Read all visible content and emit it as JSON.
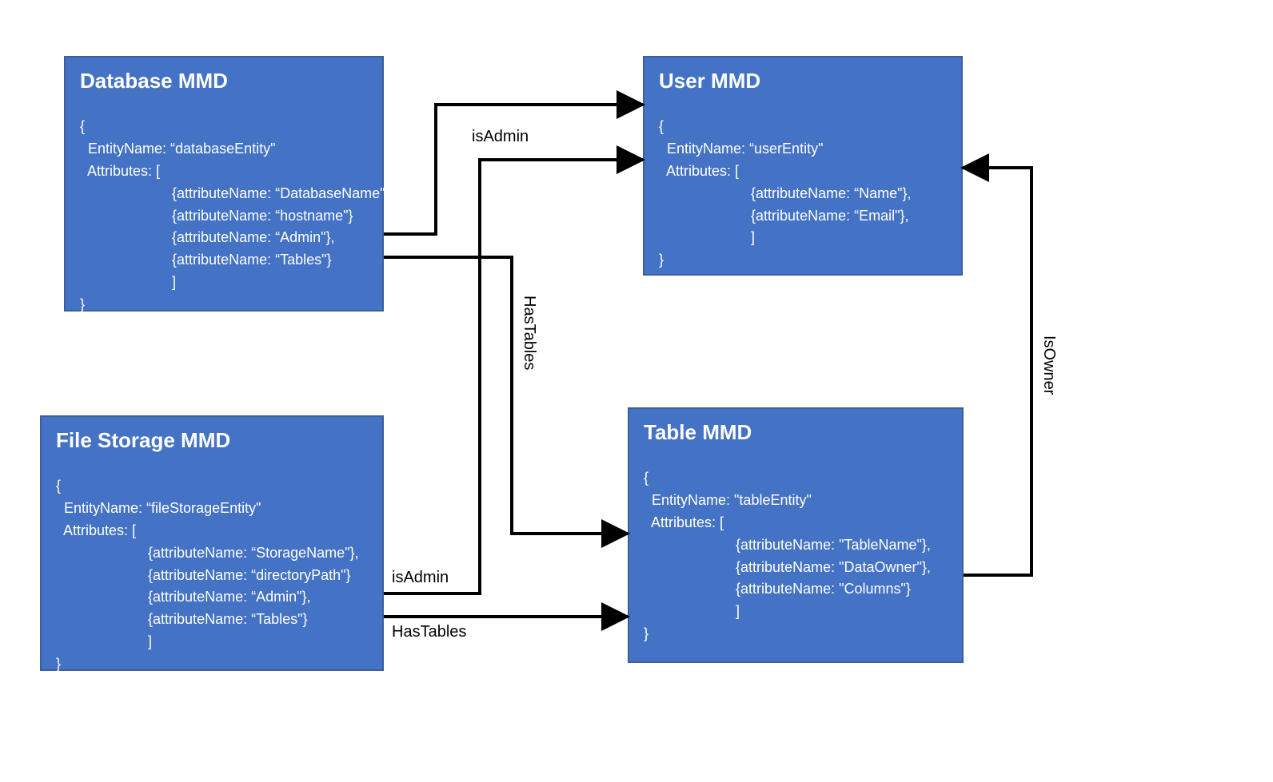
{
  "boxes": {
    "database": {
      "title": "Database MMD",
      "body": "{\n  EntityName: “databaseEntity\"\n  Attributes: [\n                       {attributeName: “DatabaseName\"},\n                       {attributeName: “hostname\"}\n                       {attributeName: “Admin\"},\n                       {attributeName: “Tables\"}\n                       ]\n}"
    },
    "user": {
      "title": "User MMD",
      "body": "{\n  EntityName: “userEntity\"\n  Attributes: [\n                       {attributeName: “Name\"},\n                       {attributeName: “Email\"},\n                       ]\n}"
    },
    "filestorage": {
      "title": "File Storage MMD",
      "body": "{\n  EntityName: “fileStorageEntity\"\n  Attributes: [\n                       {attributeName: “StorageName\"},\n                       {attributeName: “directoryPath\"}\n                       {attributeName: “Admin\"},\n                       {attributeName: “Tables\"}\n                       ]\n}"
    },
    "table": {
      "title": "Table MMD",
      "body": "{\n  EntityName: \"tableEntity\"\n  Attributes: [\n                       {attributeName: \"TableName\"},\n                       {attributeName: \"DataOwner\"},\n                       {attributeName: \"Columns\"}\n                       ]\n}"
    }
  },
  "edges": {
    "db_admin_to_user": "isAdmin",
    "db_tables_to_table": "HasTables",
    "fs_admin_to_user": "isAdmin",
    "fs_tables_to_table": "HasTables",
    "table_owner_to_user": "IsOwner"
  }
}
